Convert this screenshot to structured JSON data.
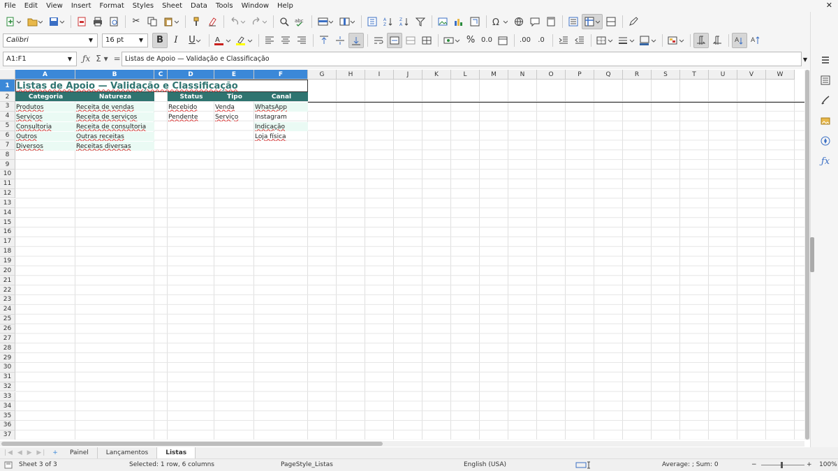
{
  "menu": [
    "File",
    "Edit",
    "View",
    "Insert",
    "Format",
    "Styles",
    "Sheet",
    "Data",
    "Tools",
    "Window",
    "Help"
  ],
  "close_glyph": "✕",
  "toolbar": {
    "font_name": "Calibri",
    "font_size": "16 pt",
    "bold": "B",
    "italic": "I",
    "underline": "U"
  },
  "formula_bar": {
    "name_box": "A1:F1",
    "content": "Listas de Apoio — Validação e Classificação"
  },
  "columns": [
    "A",
    "B",
    "C",
    "D",
    "E",
    "F",
    "G",
    "H",
    "I",
    "J",
    "K",
    "L",
    "M",
    "N",
    "O",
    "P",
    "Q",
    "R",
    "S",
    "T",
    "U",
    "V",
    "W"
  ],
  "rows": [
    "1",
    "2",
    "3",
    "4",
    "5",
    "6",
    "7",
    "8",
    "9",
    "10",
    "11",
    "12",
    "13",
    "14",
    "15",
    "16",
    "17",
    "18",
    "19",
    "20",
    "21",
    "22",
    "23",
    "24",
    "25",
    "26",
    "27",
    "28",
    "29",
    "30",
    "31",
    "32",
    "33",
    "34",
    "35",
    "36",
    "37"
  ],
  "sheet": {
    "title": "Listas de Apoio — Validação e Classificação",
    "headers": {
      "categoria": "Categoria",
      "natureza": "Natureza",
      "status": "Status",
      "tipo": "Tipo",
      "canal": "Canal"
    },
    "categoria": [
      "Produtos",
      "Serviços",
      "Consultoria",
      "Outros",
      "Diversos"
    ],
    "natureza": [
      "Receita de vendas",
      "Receita de serviços",
      "Receita de consultoria",
      "Outras receitas",
      "Receitas diversas"
    ],
    "status": [
      "Recebido",
      "Pendente"
    ],
    "tipo": [
      "Venda",
      "Serviço"
    ],
    "canal": [
      "WhatsApp",
      "Instagram",
      "Indicação",
      "Loja física"
    ]
  },
  "tabs": {
    "sheet1": "Painel",
    "sheet2": "Lançamentos",
    "sheet3": "Listas"
  },
  "status_bar": {
    "sheet_pos": "Sheet 3 of 3",
    "selection": "Selected: 1 row, 6 columns",
    "page_style": "PageStyle_Listas",
    "language": "English (USA)",
    "summary": "Average: ; Sum: 0",
    "zoom": "100%"
  },
  "colors": {
    "header_fill": "#2f7470",
    "tint_fill": "#eafaf4",
    "selection": "#3b88d8"
  }
}
